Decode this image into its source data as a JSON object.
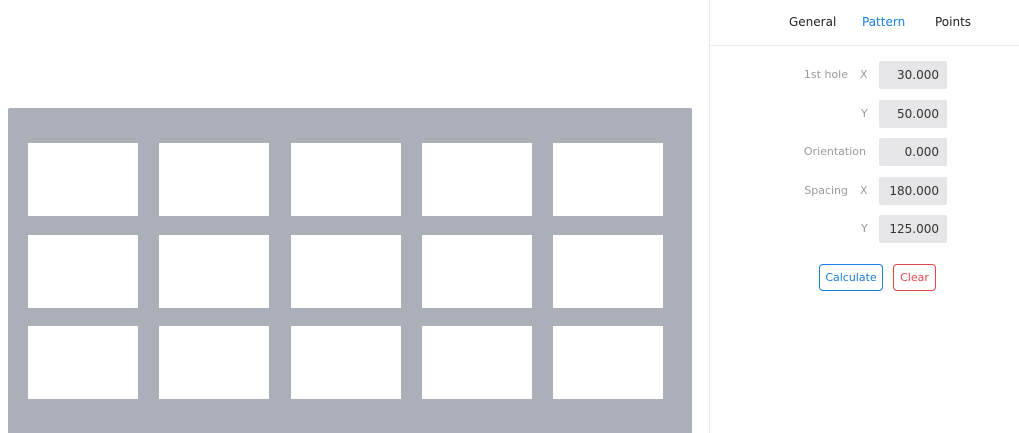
{
  "tabs": {
    "general": "General",
    "pattern": "Pattern",
    "points": "Points"
  },
  "form": {
    "first_hole_label": "1st hole",
    "x_axis": "X",
    "y_axis": "Y",
    "first_hole_x": "30.000",
    "first_hole_y": "50.000",
    "orientation_label": "Orientation",
    "orientation": "0.000",
    "spacing_label": "Spacing",
    "spacing_x": "180.000",
    "spacing_y": "125.000"
  },
  "buttons": {
    "calculate": "Calculate",
    "clear": "Clear"
  },
  "pattern": {
    "rows": 3,
    "columns": 5
  },
  "colors": {
    "plate": "#abafb8",
    "accent": "#1a7fe0",
    "danger": "#e04848"
  }
}
